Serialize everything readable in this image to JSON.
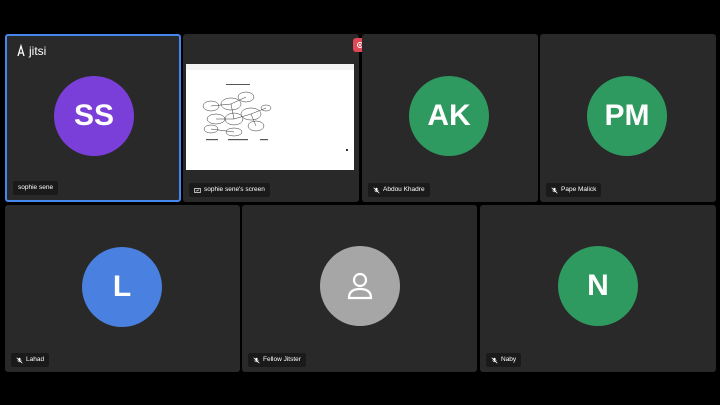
{
  "branding": {
    "logo_text": "jitsi"
  },
  "accent_color": "#4687ed",
  "participants_top": [
    {
      "name": "sophie sene",
      "initials": "SS",
      "avatar_color": "#7a3fd9",
      "active": true,
      "icon": "none"
    },
    {
      "name": "sophie sene's screen",
      "initials": "",
      "avatar_color": "",
      "active": false,
      "icon": "screen-share-icon"
    },
    {
      "name": "Abdou Khadre",
      "initials": "AK",
      "avatar_color": "#2f9a5f",
      "active": false,
      "icon": "mic-muted-icon"
    },
    {
      "name": "Pape Malick",
      "initials": "PM",
      "avatar_color": "#2f9a5f",
      "active": false,
      "icon": "mic-muted-icon"
    }
  ],
  "participants_bottom": [
    {
      "name": "Lahad",
      "initials": "L",
      "avatar_color": "#4a80e0",
      "icon": "mic-muted-icon"
    },
    {
      "name": "Fellow Jitster",
      "initials": "",
      "avatar_color": "#a6a6a6",
      "icon": "mic-muted-icon"
    },
    {
      "name": "Naby",
      "initials": "N",
      "avatar_color": "#2f9a5f",
      "icon": "mic-muted-icon"
    }
  ]
}
